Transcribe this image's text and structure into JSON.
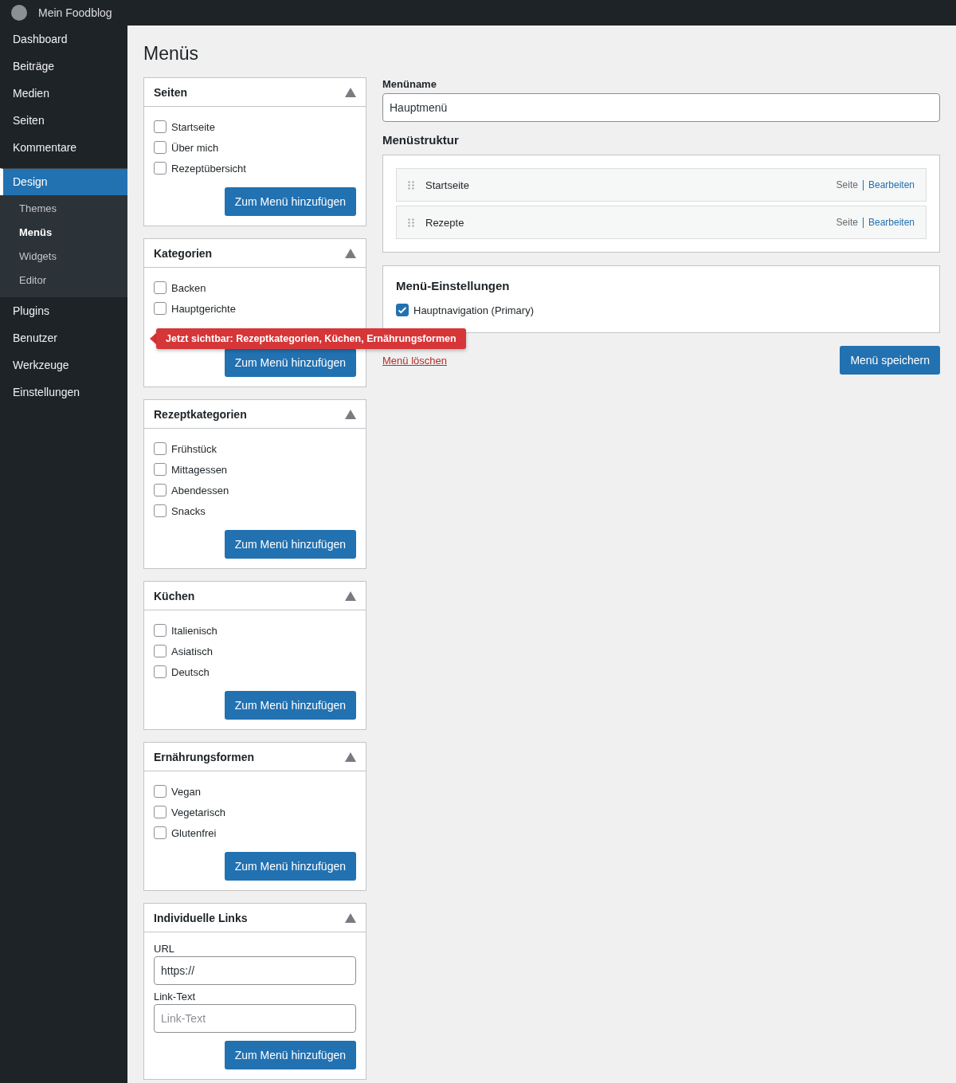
{
  "site_title": "Mein Foodblog",
  "sidebar": {
    "items": [
      {
        "label": "Dashboard",
        "selected": false
      },
      {
        "label": "Beiträge",
        "selected": false
      },
      {
        "label": "Medien",
        "selected": false
      },
      {
        "label": "Seiten",
        "selected": false
      },
      {
        "label": "Kommentare",
        "selected": false
      },
      {
        "label": "Design",
        "selected": true,
        "children": [
          {
            "label": "Themes",
            "selected": false
          },
          {
            "label": "Menüs",
            "selected": true
          },
          {
            "label": "Widgets",
            "selected": false
          },
          {
            "label": "Editor",
            "selected": false
          }
        ]
      },
      {
        "label": "Plugins",
        "selected": false
      },
      {
        "label": "Benutzer",
        "selected": false
      },
      {
        "label": "Werkzeuge",
        "selected": false
      },
      {
        "label": "Einstellungen",
        "selected": false
      }
    ]
  },
  "page_title": "Menüs",
  "panels": [
    {
      "title": "Seiten",
      "expanded": true,
      "kind": "checklist",
      "items": [
        {
          "label": "Startseite",
          "checked": false
        },
        {
          "label": "Über mich",
          "checked": false
        },
        {
          "label": "Rezeptübersicht",
          "checked": false
        }
      ],
      "button": "Zum Menü hinzufügen"
    },
    {
      "title": "Kategorien",
      "expanded": true,
      "kind": "checklist",
      "items": [
        {
          "label": "Backen",
          "checked": false
        },
        {
          "label": "Hauptgerichte",
          "checked": false
        }
      ],
      "notice": "Jetzt sichtbar: Rezeptkategorien, Küchen, Ernährungsformen",
      "button": "Zum Menü hinzufügen"
    },
    {
      "title": "Rezeptkategorien",
      "expanded": true,
      "kind": "checklist",
      "items": [
        {
          "label": "Frühstück",
          "checked": false
        },
        {
          "label": "Mittagessen",
          "checked": false
        },
        {
          "label": "Abendessen",
          "checked": false
        },
        {
          "label": "Snacks",
          "checked": false
        }
      ],
      "button": "Zum Menü hinzufügen"
    },
    {
      "title": "Küchen",
      "expanded": true,
      "kind": "checklist",
      "items": [
        {
          "label": "Italienisch",
          "checked": false
        },
        {
          "label": "Asiatisch",
          "checked": false
        },
        {
          "label": "Deutsch",
          "checked": false
        }
      ],
      "button": "Zum Menü hinzufügen"
    },
    {
      "title": "Ernährungsformen",
      "expanded": true,
      "kind": "checklist",
      "items": [
        {
          "label": "Vegan",
          "checked": false
        },
        {
          "label": "Vegetarisch",
          "checked": false
        },
        {
          "label": "Glutenfrei",
          "checked": false
        }
      ],
      "button": "Zum Menü hinzufügen"
    },
    {
      "title": "Individuelle Links",
      "expanded": true,
      "kind": "links",
      "fields": [
        {
          "label": "URL",
          "value": "https://"
        },
        {
          "label": "Link-Text",
          "placeholder": "Link-Text"
        }
      ],
      "button": "Zum Menü hinzufügen"
    }
  ],
  "menu_name": {
    "label": "Menüname",
    "value": "Hauptmenü"
  },
  "structure": {
    "title": "Menüstruktur",
    "items": [
      {
        "label": "Startseite",
        "type": "Seite",
        "action": "Bearbeiten"
      },
      {
        "label": "Rezepte",
        "type": "Seite",
        "action": "Bearbeiten"
      }
    ]
  },
  "settings": {
    "title": "Menü-Einstellungen",
    "locations": [
      {
        "label": "Hauptnavigation (Primary)",
        "checked": true
      }
    ]
  },
  "delete_link": "Menü löschen",
  "save_button": "Menü speichern"
}
